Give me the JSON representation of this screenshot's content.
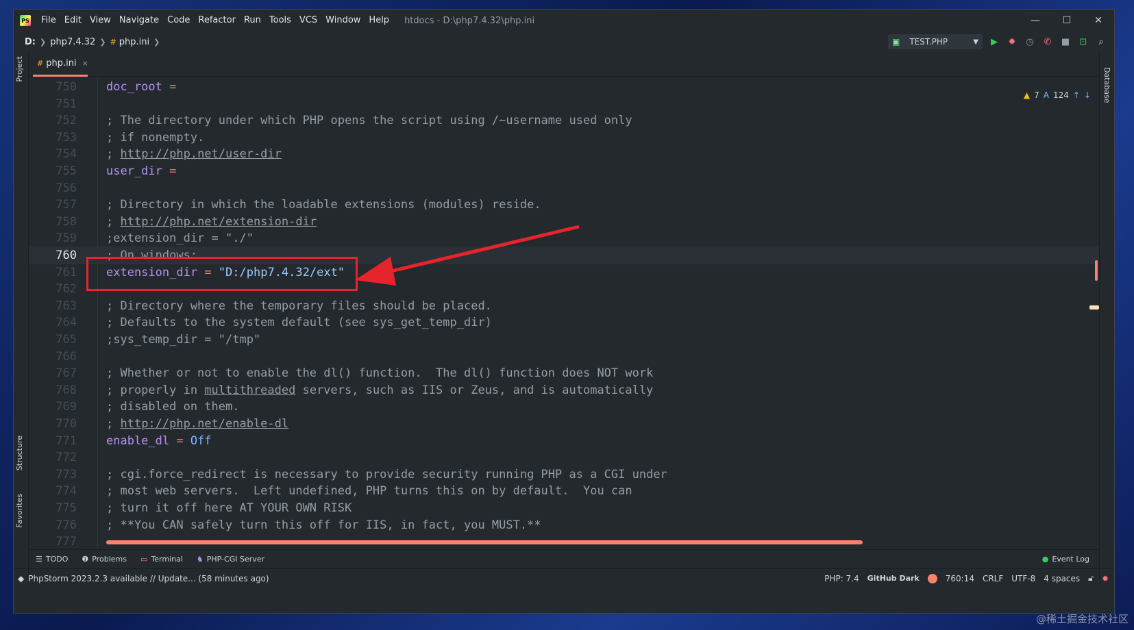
{
  "window": {
    "title": "htdocs - D:\\php7.4.32\\php.ini",
    "menu": [
      "File",
      "Edit",
      "View",
      "Navigate",
      "Code",
      "Refactor",
      "Run",
      "Tools",
      "VCS",
      "Window",
      "Help"
    ],
    "controls": {
      "minimize": "—",
      "maximize": "☐",
      "close": "✕"
    }
  },
  "breadcrumb": {
    "drive": "D:",
    "folder": "php7.4.32",
    "file": "php.ini"
  },
  "run_config": {
    "name": "TEST.PHP"
  },
  "toolwindows_left": {
    "project": "Project",
    "structure": "Structure",
    "favorites": "Favorites"
  },
  "toolwindows_right": {
    "database": "Database"
  },
  "tab": {
    "label": "php.ini",
    "close": "×"
  },
  "inspections": {
    "warnings": "7",
    "typos": "124"
  },
  "annotation": {
    "color": "#e5242b"
  },
  "lines": [
    {
      "n": "750",
      "segments": [
        {
          "t": "doc_root",
          "c": "key"
        },
        {
          "t": " ",
          "c": ""
        },
        {
          "t": "=",
          "c": "op"
        }
      ]
    },
    {
      "n": "751",
      "segments": []
    },
    {
      "n": "752",
      "segments": [
        {
          "t": "; The directory under which PHP opens the script using /~username used only",
          "c": "comment"
        }
      ]
    },
    {
      "n": "753",
      "segments": [
        {
          "t": "; if nonempty.",
          "c": "comment"
        }
      ]
    },
    {
      "n": "754",
      "segments": [
        {
          "t": "; ",
          "c": "comment"
        },
        {
          "t": "http://php.net/user-dir",
          "c": "link"
        }
      ]
    },
    {
      "n": "755",
      "segments": [
        {
          "t": "user_dir",
          "c": "key"
        },
        {
          "t": " ",
          "c": ""
        },
        {
          "t": "=",
          "c": "op"
        }
      ]
    },
    {
      "n": "756",
      "segments": []
    },
    {
      "n": "757",
      "segments": [
        {
          "t": "; Directory in which the loadable extensions (modules) reside.",
          "c": "comment"
        }
      ]
    },
    {
      "n": "758",
      "segments": [
        {
          "t": "; ",
          "c": "comment"
        },
        {
          "t": "http://php.net/extension-dir",
          "c": "link"
        }
      ]
    },
    {
      "n": "759",
      "segments": [
        {
          "t": ";extension_dir = \"./\"",
          "c": "comment"
        }
      ]
    },
    {
      "n": "760",
      "segments": [
        {
          "t": "; On windows:",
          "c": "comment"
        }
      ],
      "current": true
    },
    {
      "n": "761",
      "segments": [
        {
          "t": "extension_dir",
          "c": "key"
        },
        {
          "t": " ",
          "c": ""
        },
        {
          "t": "=",
          "c": "op"
        },
        {
          "t": " ",
          "c": ""
        },
        {
          "t": "\"D:/php7.4.32/ext\"",
          "c": "str"
        }
      ]
    },
    {
      "n": "762",
      "segments": []
    },
    {
      "n": "763",
      "segments": [
        {
          "t": "; Directory where the temporary files should be placed.",
          "c": "comment"
        }
      ]
    },
    {
      "n": "764",
      "segments": [
        {
          "t": "; Defaults to the system default (see sys_get_temp_dir)",
          "c": "comment"
        }
      ]
    },
    {
      "n": "765",
      "segments": [
        {
          "t": ";sys_temp_dir = \"/tmp\"",
          "c": "comment"
        }
      ]
    },
    {
      "n": "766",
      "segments": []
    },
    {
      "n": "767",
      "segments": [
        {
          "t": "; Whether or not to enable the dl() function.  The dl() function does NOT work",
          "c": "comment"
        }
      ]
    },
    {
      "n": "768",
      "segments": [
        {
          "t": "; properly in ",
          "c": "comment"
        },
        {
          "t": "multithreaded",
          "c": "link"
        },
        {
          "t": " servers, such as IIS or Zeus, and is automatically",
          "c": "comment"
        }
      ]
    },
    {
      "n": "769",
      "segments": [
        {
          "t": "; disabled on them.",
          "c": "comment"
        }
      ]
    },
    {
      "n": "770",
      "segments": [
        {
          "t": "; ",
          "c": "comment"
        },
        {
          "t": "http://php.net/enable-dl",
          "c": "link"
        }
      ]
    },
    {
      "n": "771",
      "segments": [
        {
          "t": "enable_dl",
          "c": "key"
        },
        {
          "t": " ",
          "c": ""
        },
        {
          "t": "=",
          "c": "op"
        },
        {
          "t": " ",
          "c": ""
        },
        {
          "t": "Off",
          "c": "val"
        }
      ]
    },
    {
      "n": "772",
      "segments": []
    },
    {
      "n": "773",
      "segments": [
        {
          "t": "; cgi.force_redirect is necessary to provide security running PHP as a CGI under",
          "c": "comment"
        }
      ]
    },
    {
      "n": "774",
      "segments": [
        {
          "t": "; most web servers.  Left undefined, PHP turns this on by default.  You can",
          "c": "comment"
        }
      ]
    },
    {
      "n": "775",
      "segments": [
        {
          "t": "; turn it off here AT YOUR OWN RISK",
          "c": "comment"
        }
      ]
    },
    {
      "n": "776",
      "segments": [
        {
          "t": "; **You CAN safely turn this off for IIS, in fact, you MUST.**",
          "c": "comment"
        }
      ]
    },
    {
      "n": "777",
      "segments": []
    }
  ],
  "toolbar_bottom": {
    "todo": "TODO",
    "problems": "Problems",
    "terminal": "Terminal",
    "phpcgi": "PHP-CGI Server",
    "eventlog": "Event Log"
  },
  "status": {
    "message": "PhpStorm 2023.2.3 available // Update... (58 minutes ago)",
    "php": "PHP: 7.4",
    "theme": "GitHub Dark",
    "position": "760:14",
    "line_sep": "CRLF",
    "encoding": "UTF-8",
    "indent": "4 spaces"
  },
  "watermark": "@稀土掘金技术社区"
}
